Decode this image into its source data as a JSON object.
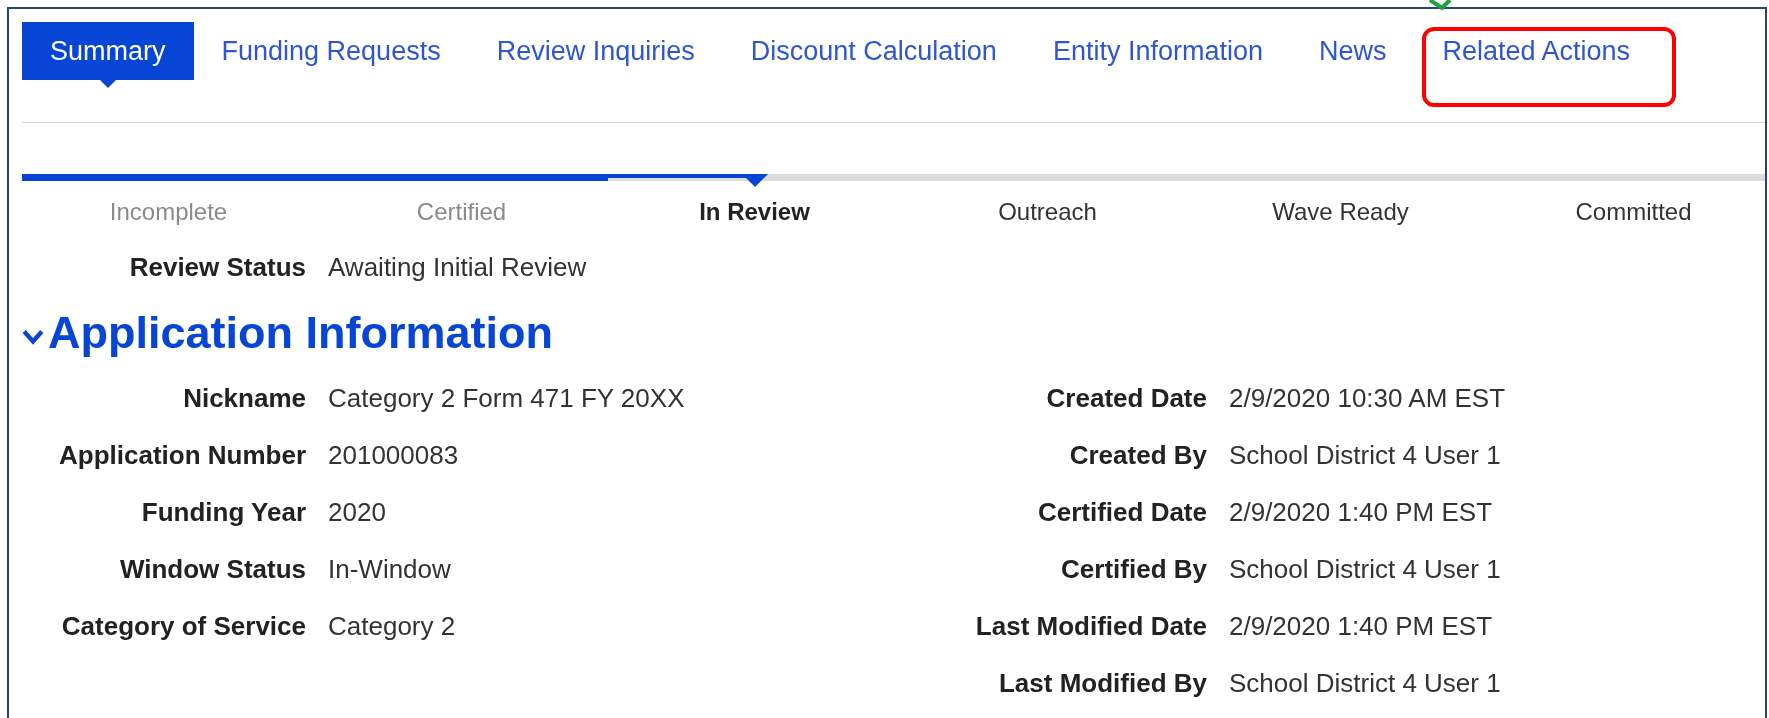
{
  "tabs": [
    {
      "label": "Summary",
      "selected": true,
      "highlighted": false
    },
    {
      "label": "Funding Requests",
      "selected": false,
      "highlighted": false
    },
    {
      "label": "Review Inquiries",
      "selected": false,
      "highlighted": false
    },
    {
      "label": "Discount Calculation",
      "selected": false,
      "highlighted": false
    },
    {
      "label": "Entity Information",
      "selected": false,
      "highlighted": false
    },
    {
      "label": "News",
      "selected": false,
      "highlighted": false
    },
    {
      "label": "Related Actions",
      "selected": false,
      "highlighted": true
    }
  ],
  "progress": {
    "steps": [
      {
        "label": "Incomplete",
        "completed": true,
        "current": false
      },
      {
        "label": "Certified",
        "completed": true,
        "current": false
      },
      {
        "label": "In Review",
        "completed": false,
        "current": true
      },
      {
        "label": "Outreach",
        "completed": false,
        "current": false
      },
      {
        "label": "Wave Ready",
        "completed": false,
        "current": false
      },
      {
        "label": "Committed",
        "completed": false,
        "current": false
      }
    ]
  },
  "review_status": {
    "label": "Review Status",
    "value": "Awaiting Initial Review"
  },
  "section": {
    "title": "Application Information",
    "expanded": true,
    "left_fields": [
      {
        "label": "Nickname",
        "value": "Category 2 Form 471 FY 20XX"
      },
      {
        "label": "Application Number",
        "value": "201000083"
      },
      {
        "label": "Funding Year",
        "value": "2020"
      },
      {
        "label": "Window Status",
        "value": "In-Window"
      },
      {
        "label": "Category of Service",
        "value": "Category 2"
      }
    ],
    "right_fields": [
      {
        "label": "Created Date",
        "value": "2/9/2020 10:30 AM EST"
      },
      {
        "label": "Created By",
        "value": "School District 4 User 1"
      },
      {
        "label": "Certified Date",
        "value": "2/9/2020 1:40 PM EST"
      },
      {
        "label": "Certified By",
        "value": "School District 4 User 1"
      },
      {
        "label": "Last Modified Date",
        "value": "2/9/2020 1:40 PM EST"
      },
      {
        "label": "Last Modified By",
        "value": "School District 4 User 1"
      }
    ]
  }
}
